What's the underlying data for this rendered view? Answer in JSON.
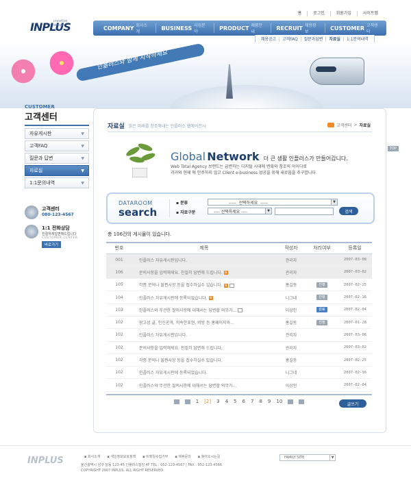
{
  "util_links": [
    "홈",
    "로그인",
    "회원가입",
    "사이트맵"
  ],
  "logo": {
    "mark": "INPLUS",
    "sub": "creative design"
  },
  "gnb": [
    {
      "en": "COMPANY",
      "ko": "회사소개"
    },
    {
      "en": "BUSINESS",
      "ko": "사업분야"
    },
    {
      "en": "PRODUCT",
      "ko": "제품안내"
    },
    {
      "en": "RECRUIT",
      "ko": "채용정보"
    },
    {
      "en": "CUSTOMER",
      "ko": "고객센터"
    }
  ],
  "subnav": [
    "채용공고",
    "고객FAQ",
    "질문과답변",
    "자료실",
    "1:1문의내역"
  ],
  "banner": {
    "slogan": "인플러스와 함께 시작하세요"
  },
  "lnb": {
    "en": "CUSTOMER",
    "title": "고객센터",
    "items": [
      "자유게시판",
      "고객FAQ",
      "질문과 답변",
      "자료실",
      "1:1문의내역"
    ]
  },
  "cs": {
    "center_title": "고객센터",
    "center_phone": "080-123-4567",
    "consult_title": "1:1 전화상담",
    "consult_desc": "친절하게답변해드립니다",
    "consult_en": "CUSTOMER CENTER",
    "consult_btn": "바로가기"
  },
  "top_btn": "TOP",
  "page": {
    "title": "자료실",
    "desc": "밝은 미래를 창조해내는 인플러스 웹에이전시",
    "breadcrumb": [
      "고객센터",
      "자료실"
    ]
  },
  "network": {
    "w1": "Global",
    "w2": "Network",
    "w3": "더 큰 생활 인플러스가 만들어갑니다.",
    "l2": "Web Total Agency 브랜드는 급변하는 디지털 시대에 변화와 창조의 아이디로",
    "l3": "과거와 현재 에 만주하지 않고 Client e-business 성공을 위해 새로움을 추구합니다"
  },
  "search": {
    "lbl1": "DATAROOM",
    "lbl2": "search",
    "f1_label": "분류",
    "f1_value": "선택하세요",
    "f2_label": "자료구분",
    "f2_value": "선택하세요",
    "button": "검색"
  },
  "count_text": "총 106건의 게시물이 있습니다.",
  "table": {
    "headers": [
      "번호",
      "제목",
      "작성자",
      "처리여부",
      "등록일"
    ],
    "rows": [
      {
        "no": "001",
        "title": "인플러스 자유게시판입니다.",
        "new": false,
        "cm": false,
        "writer": "관리자",
        "status": "",
        "date": "2007-03-08",
        "hl": true
      },
      {
        "no": "106",
        "title": "문의사항을 입력해세요. 친절히 답변해 드립니다.",
        "new": true,
        "cm": false,
        "writer": "관리자",
        "status": "",
        "date": "2007-03-02",
        "hl": true
      },
      {
        "no": "105",
        "title": "각종 문의나 불편사항 등을 접수하실수 있습니다.",
        "new": true,
        "cm": true,
        "writer": "홍길동",
        "status": "진행",
        "date": "2007-02-25",
        "hl": false
      },
      {
        "no": "104",
        "title": "인플러스 자유게시판에 등록되었습니다.",
        "new": true,
        "cm": false,
        "writer": "니그네",
        "status": "진행",
        "date": "2007-02-16",
        "hl": false
      },
      {
        "no": "103",
        "title": "인플러스와 무관한 질의사항에 대해서는 답변할 의무가...",
        "new": false,
        "cm": true,
        "writer": "이상민",
        "status": "완료",
        "date": "2007-02-04",
        "hl": false
      },
      {
        "no": "102",
        "title": "광고성 글, 인신공격, 저속한표현, 비방 등 홍페이지와...",
        "new": false,
        "cm": false,
        "writer": "홍길동",
        "status": "진행",
        "date": "2007-01-28",
        "hl": false
      },
      {
        "no": "102",
        "title": "인플러스 자유게시판입니다.",
        "new": false,
        "cm": false,
        "writer": "관리자",
        "status": "",
        "date": "2007-03-08",
        "hl": false
      },
      {
        "no": "102",
        "title": "문의사항을 입력해세요. 친절히 답변해 드립니다.",
        "new": false,
        "cm": false,
        "writer": "관리자",
        "status": "",
        "date": "2007-03-02",
        "hl": false
      },
      {
        "no": "102",
        "title": "각종 문의나 불편사항 등을 접수하실수 있습니다.",
        "new": false,
        "cm": false,
        "writer": "홍길동",
        "status": "",
        "date": "2007-02-25",
        "hl": false
      },
      {
        "no": "102",
        "title": "인플러스 자유게시판에 등록되었습니다.",
        "new": false,
        "cm": false,
        "writer": "니그네",
        "status": "",
        "date": "2007-02-16",
        "hl": false
      },
      {
        "no": "102",
        "title": "인플러스와 무관한 질의사항에 대해서는 답변할 의무가...",
        "new": false,
        "cm": false,
        "writer": "이상민",
        "status": "",
        "date": "2007-02-04",
        "hl": false
      }
    ]
  },
  "pagination": {
    "current": "2",
    "pages": [
      "1",
      "2",
      "3",
      "4",
      "5",
      "6",
      "7",
      "8",
      "9",
      "10"
    ]
  },
  "write_btn": "글쓰기",
  "footer": {
    "links": [
      "회사소개",
      "개인정보보호정책",
      "이메일수집거부",
      "제휴문의",
      "찾아오시는길"
    ],
    "addr1": "울산광역시 남구 달동 123-45 인플러스빌딩 4F   TEL : 052-123-4567  |  FAX : 052-123-4566",
    "addr2": "COPYRIGHT 2007 INPLUS. ALL RIGHT RESERVED.",
    "family_site": "FAMILY SITE"
  }
}
